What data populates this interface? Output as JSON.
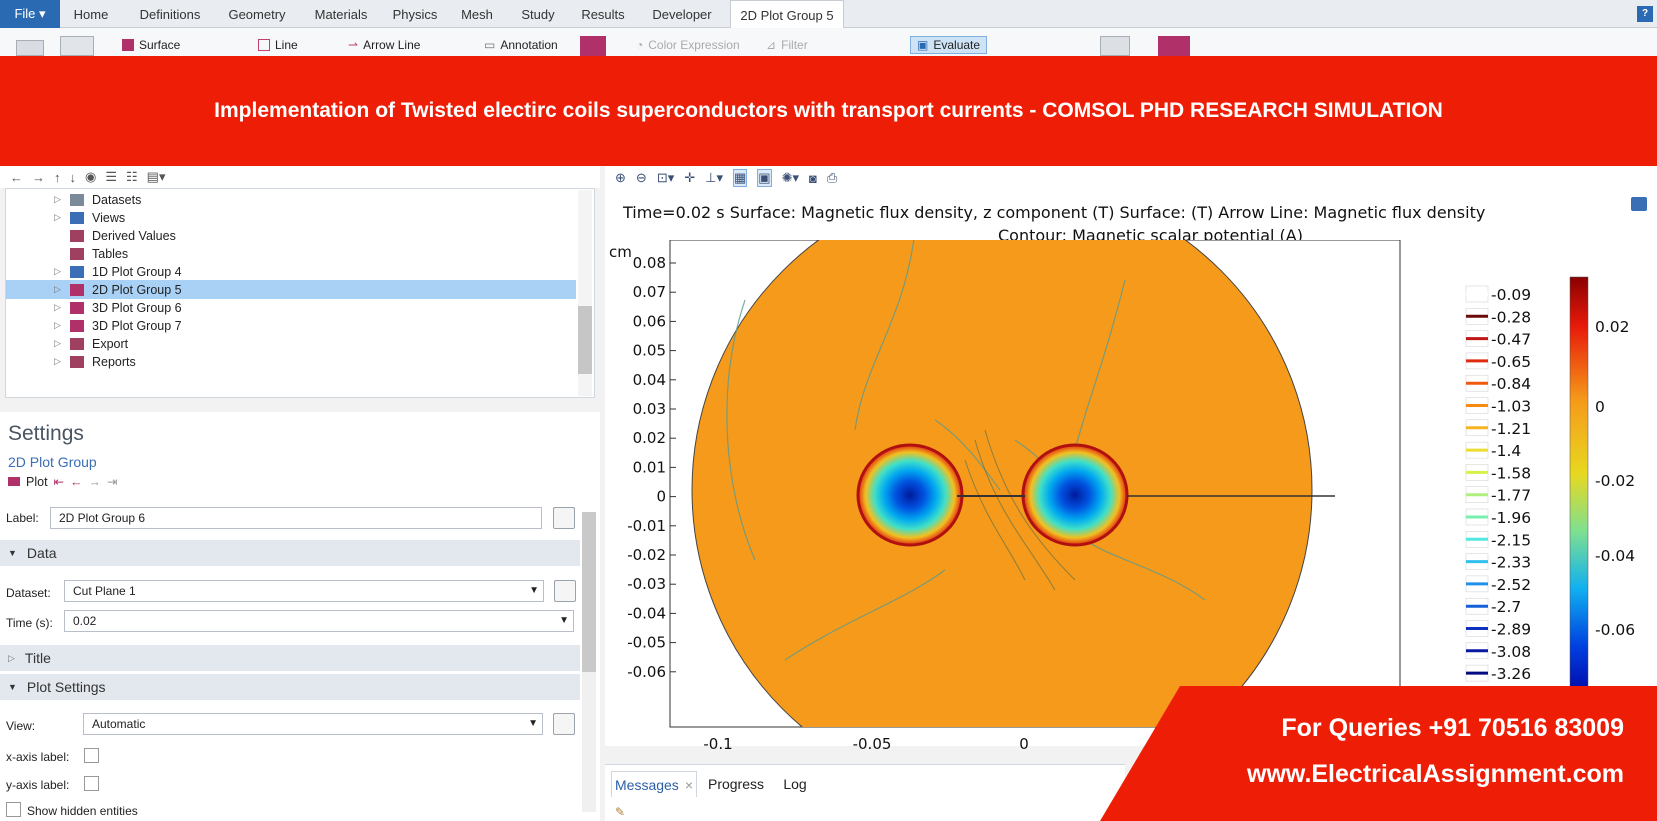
{
  "menu": {
    "file_label": "File ▾",
    "tabs": [
      "Home",
      "Definitions",
      "Geometry",
      "Materials",
      "Physics",
      "Mesh",
      "Study",
      "Results",
      "Developer",
      "2D Plot Group 5"
    ],
    "help": "?"
  },
  "ribbon": {
    "surface": "Surface",
    "line": "Line",
    "arrow_line": "Arrow Line",
    "annotation": "Annotation",
    "color_expression": "Color Expression",
    "filter": "Filter",
    "evaluate": "Evaluate"
  },
  "banner": {
    "text": "Implementation of Twisted electirc coils superconductors with transport currents - COMSOL PHD RESEARCH SIMULATION"
  },
  "tree": {
    "items": [
      {
        "label": "Datasets",
        "selected": false
      },
      {
        "label": "Views",
        "selected": false
      },
      {
        "label": "Derived Values",
        "selected": false
      },
      {
        "label": "Tables",
        "selected": false
      },
      {
        "label": "1D Plot Group 4",
        "selected": false
      },
      {
        "label": "2D Plot Group 5",
        "selected": true
      },
      {
        "label": "3D Plot Group 6",
        "selected": false
      },
      {
        "label": "3D Plot Group 7",
        "selected": false
      },
      {
        "label": "Export",
        "selected": false
      },
      {
        "label": "Reports",
        "selected": false
      }
    ]
  },
  "settings": {
    "title": "Settings",
    "subtitle": "2D Plot Group",
    "plot_label": "Plot",
    "label_caption": "Label:",
    "label_value": "2D Plot Group 6",
    "data_section": "Data",
    "dataset_caption": "Dataset:",
    "dataset_value": "Cut Plane 1",
    "time_caption": "Time (s):",
    "time_value": "0.02",
    "title_section": "Title",
    "plot_settings_section": "Plot Settings",
    "view_caption": "View:",
    "view_value": "Automatic",
    "xaxis_caption": "x-axis label:",
    "yaxis_caption": "y-axis label:",
    "show_hidden": "Show hidden entities"
  },
  "graphics": {
    "title_line1": "Time=0.02 s  Surface: Magnetic flux density, z component (T)  Surface:  (T)  Arrow Line: Magnetic flux density",
    "title_line2": "Contour: Magnetic scalar potential (A)",
    "y_unit": "cm",
    "y_ticks": [
      "0.08",
      "0.07",
      "0.06",
      "0.05",
      "0.04",
      "0.03",
      "0.02",
      "0.01",
      "0",
      "-0.01",
      "-0.02",
      "-0.03",
      "-0.04",
      "-0.05",
      "-0.06"
    ],
    "x_ticks": [
      "-0.1",
      "-0.05",
      "0"
    ],
    "contour_legend": [
      "-0.09",
      "-0.28",
      "-0.47",
      "-0.65",
      "-0.84",
      "-1.03",
      "-1.21",
      "-1.4",
      "-1.58",
      "-1.77",
      "-1.96",
      "-2.15",
      "-2.33",
      "-2.52",
      "-2.7",
      "-2.89",
      "-3.08",
      "-3.26"
    ],
    "contour_colors": [
      "#ffffff",
      "#6a0a0a",
      "#c01515",
      "#e02a10",
      "#f05a10",
      "#f58a15",
      "#f5b520",
      "#ecdc30",
      "#d8f04a",
      "#aef080",
      "#78f0b0",
      "#50e8e0",
      "#30c0f0",
      "#2090e8",
      "#1560d8",
      "#1030c0",
      "#0a1aa0",
      "#050a80"
    ],
    "colorbar_labels": [
      "0.02",
      "0",
      "-0.02",
      "-0.04",
      "-0.06"
    ]
  },
  "messages": {
    "tabs": [
      "Messages",
      "Progress",
      "Log"
    ]
  },
  "overlay": {
    "queries": "For Queries +91 70516 83009",
    "website": "www.ElectricalAssignment.com"
  },
  "colors": {
    "banner": "#ee1e06",
    "accent": "#2a6ab3",
    "selection": "#a9d1f5",
    "domain": "#f59a1a"
  }
}
